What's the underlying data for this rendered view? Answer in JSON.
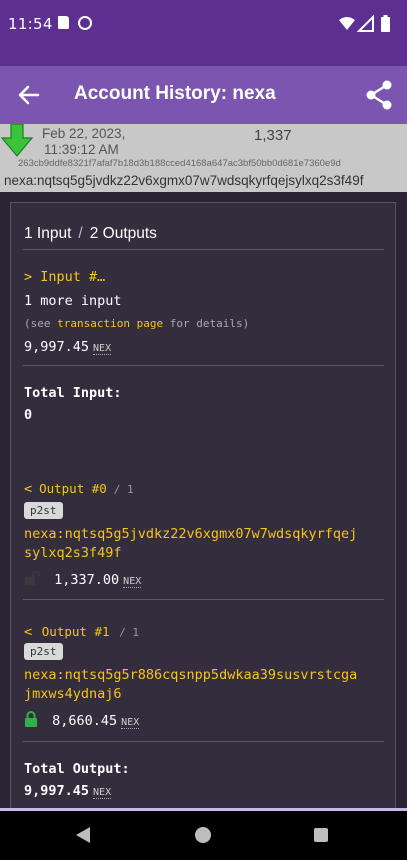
{
  "status_bar": {
    "time": "11:54"
  },
  "app_bar": {
    "title": "Account History: nexa"
  },
  "tx_header": {
    "date": "Feb 22, 2023,",
    "time": "11:39:12 AM",
    "amount": "1,337",
    "hash": "263cb9ddfe8321f7afaf7b18d3b188cced4168a647ac3bf50bb0d681e7360e9d",
    "address": "nexa:nqtsq5g5jvdkz22v6xgmx07w7wdsqkyrfqejsylxq2s3f49f"
  },
  "io_summary": {
    "inputs": "1 Input",
    "sep": "/",
    "outputs": "2 Outputs"
  },
  "input": {
    "caret": ">",
    "label": "Input #…",
    "more": "1 more input",
    "see_pre": "(see ",
    "see_link": "transaction page",
    "see_post": " for details)",
    "amount": "9,997.45",
    "unit": "NEX"
  },
  "total_input": {
    "label": "Total Input:",
    "value": "0"
  },
  "outputs": [
    {
      "caret": "<",
      "label": "Output #0",
      "of": "/ 1",
      "badge": "p2st",
      "address_line1": "nexa:nqtsq5g5jvdkz22v6xgmx07w7wdsqkyrfqej",
      "address_line2": "sylxq2s3f49f",
      "amount": "1,337.00",
      "unit": "NEX",
      "lock_color": "#3a3a3a"
    },
    {
      "caret": "<",
      "label": "Output #1",
      "of": "/ 1",
      "badge": "p2st",
      "address_line1": "nexa:nqtsq5g5r886cqsnpp5dwkaa39susvrstcga",
      "address_line2": "jmxws4ydnaj6",
      "amount": "8,660.45",
      "unit": "NEX",
      "lock_color": "#2fb24a"
    }
  ],
  "total_output": {
    "label": "Total Output:",
    "value": "9,997.45",
    "unit": "NEX"
  },
  "colors": {
    "status_bar": "#5c2f91",
    "app_bar": "#7b55b0",
    "accent": "#f5c518",
    "background": "#2b2433"
  }
}
